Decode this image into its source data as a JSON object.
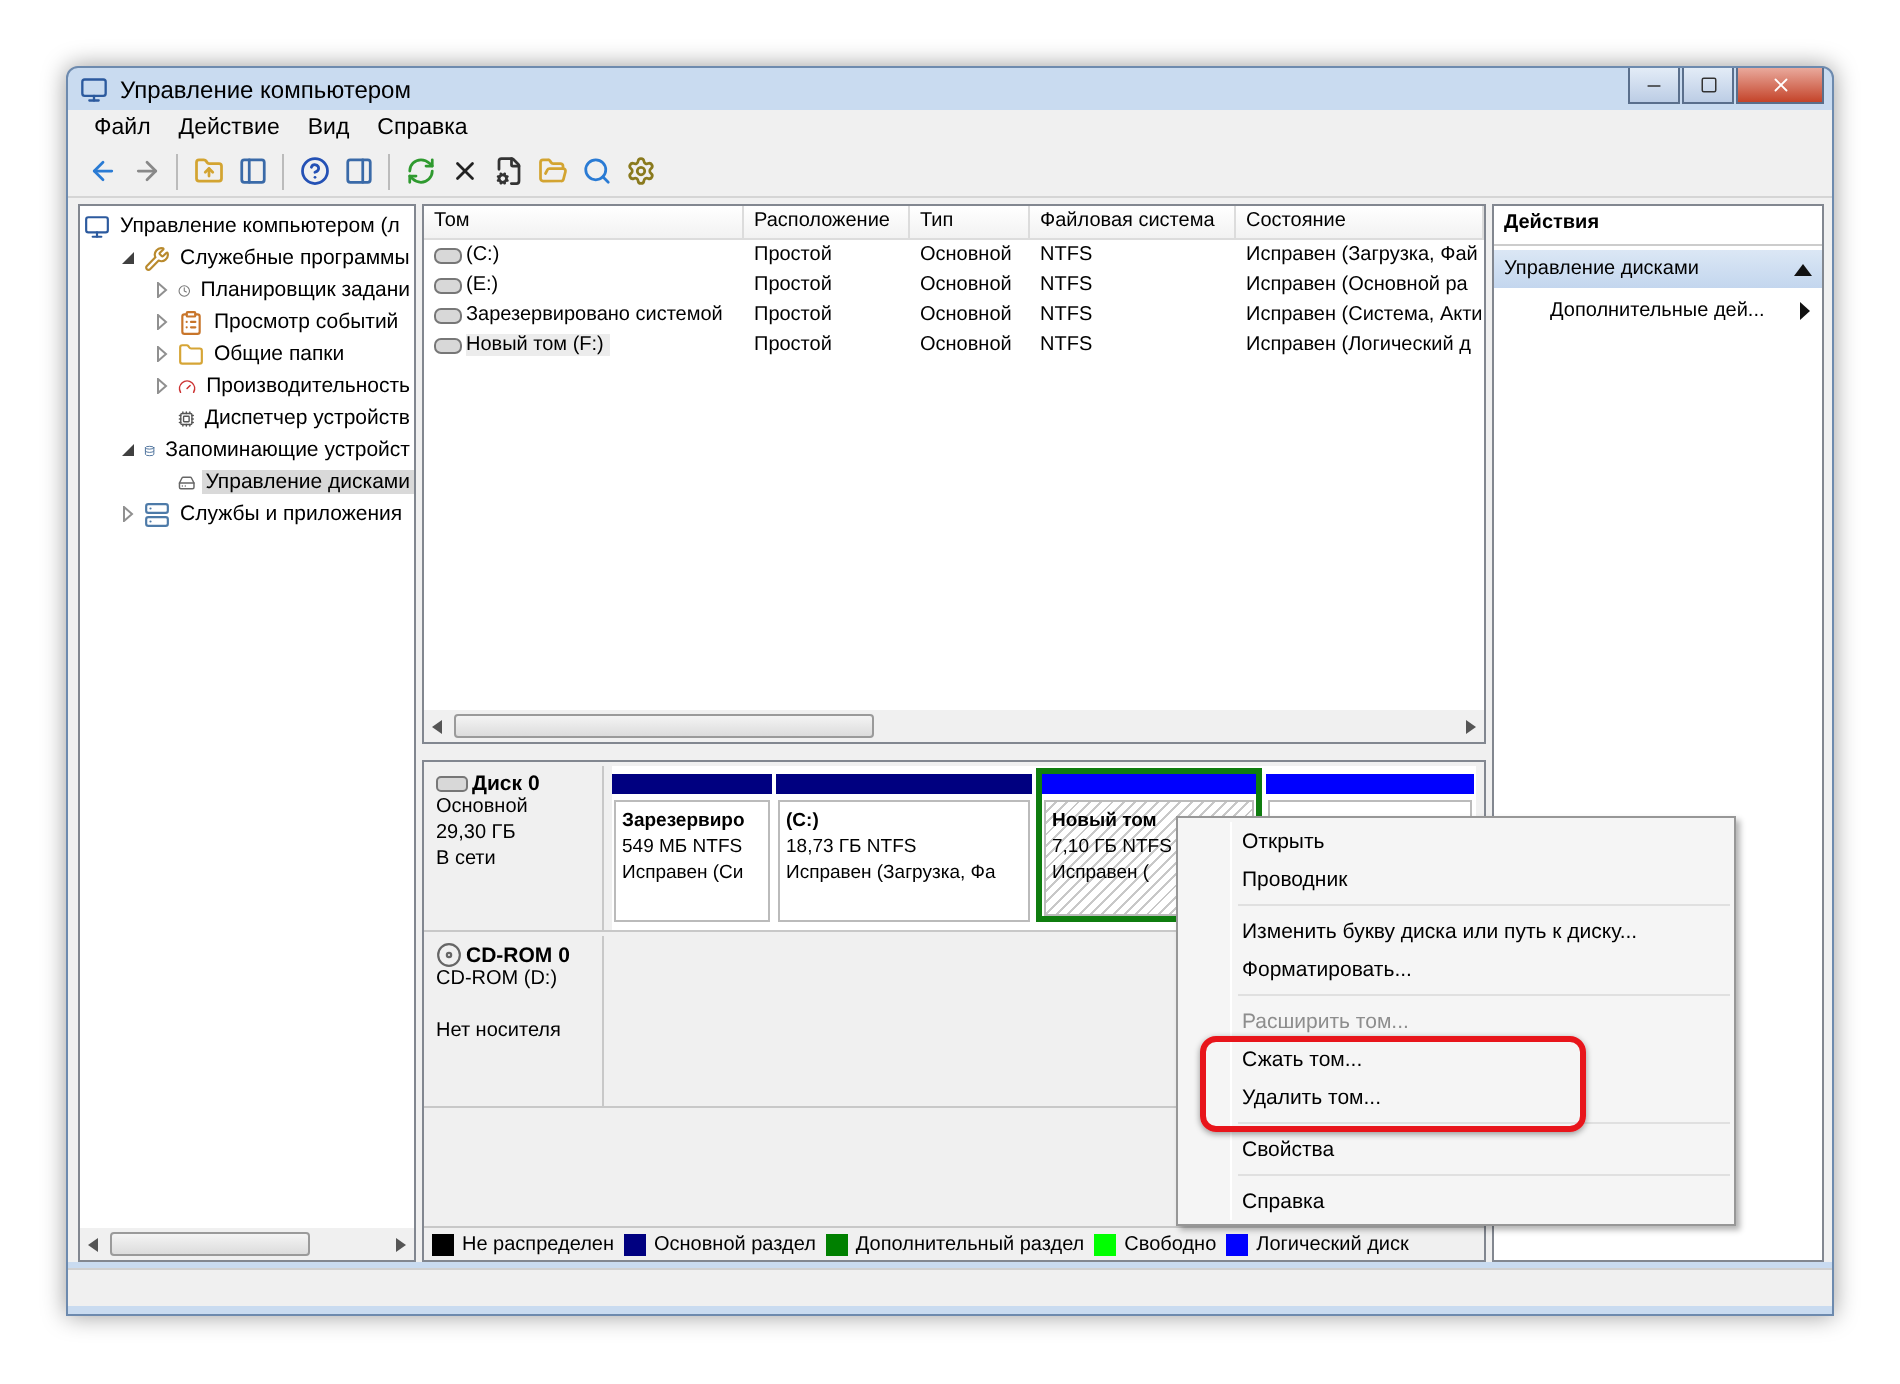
{
  "window": {
    "title": "Управление компьютером"
  },
  "menu_bar": [
    "Файл",
    "Действие",
    "Вид",
    "Справка"
  ],
  "tree": [
    {
      "label": "Управление компьютером (л",
      "selected": false,
      "children": [
        {
          "label": "Служебные программы",
          "expanded": true,
          "selected": false,
          "children": [
            {
              "label": "Планировщик задани",
              "expanded": false,
              "selected": false
            },
            {
              "label": "Просмотр событий",
              "expanded": false,
              "selected": false
            },
            {
              "label": "Общие папки",
              "expanded": false,
              "selected": false
            },
            {
              "label": "Производительность",
              "expanded": false,
              "selected": false
            },
            {
              "label": "Диспетчер устройств",
              "selected": false
            }
          ]
        },
        {
          "label": "Запоминающие устройст",
          "expanded": true,
          "selected": false,
          "children": [
            {
              "label": "Управление дисками",
              "selected": true
            }
          ]
        },
        {
          "label": "Службы и приложения",
          "expanded": false,
          "selected": false
        }
      ]
    }
  ],
  "table": {
    "columns": [
      "Том",
      "Расположение",
      "Тип",
      "Файловая система",
      "Состояние"
    ],
    "rows": [
      {
        "cells": [
          "(C:)",
          "Простой",
          "Основной",
          "NTFS",
          "Исправен (Загрузка, Фай"
        ],
        "selected": false
      },
      {
        "cells": [
          "(E:)",
          "Простой",
          "Основной",
          "NTFS",
          "Исправен (Основной ра"
        ],
        "selected": false
      },
      {
        "cells": [
          "Зарезервировано системой",
          "Простой",
          "Основной",
          "NTFS",
          "Исправен (Система, Акти"
        ],
        "selected": false
      },
      {
        "cells": [
          "Новый том (F:)",
          "Простой",
          "Основной",
          "NTFS",
          "Исправен (Логический д"
        ],
        "selected": true
      }
    ]
  },
  "disks": [
    {
      "kind": "disk",
      "name": "Диск 0",
      "lines": [
        "Основной",
        "29,30 ГБ"
      ],
      "status": "В сети",
      "partitions": [
        {
          "title": "Зарезервиро",
          "size": "549 МБ NTFS",
          "status": "Исправен (Си",
          "color": "#000080",
          "selected": false
        },
        {
          "title": "(C:)",
          "size": "18,73 ГБ NTFS",
          "status": "Исправен (Загрузка, Фа",
          "color": "#000080",
          "selected": false
        },
        {
          "title": "Новый том",
          "size": "7,10 ГБ NTFS",
          "status": "Исправен (",
          "color": "#0000ff",
          "selected": true
        },
        {
          "color": "#0000ff",
          "selected": false
        }
      ]
    },
    {
      "kind": "cdrom",
      "name": "CD-ROM 0",
      "lines": [
        "CD-ROM (D:)"
      ],
      "status": "Нет носителя"
    }
  ],
  "legend": [
    {
      "label": "Не распределен",
      "color": "#000000"
    },
    {
      "label": "Основной раздел",
      "color": "#000080"
    },
    {
      "label": "Дополнительный раздел",
      "color": "#008000"
    },
    {
      "label": "Свободно",
      "color": "#00ff00"
    },
    {
      "label": "Логический диск",
      "color": "#0000ff"
    }
  ],
  "actions": {
    "title": "Действия",
    "section": {
      "label": "Управление дисками",
      "expanded": true
    },
    "items": [
      "Дополнительные дей..."
    ]
  },
  "context_menu": [
    [
      {
        "kind": "item",
        "label": "Открыть",
        "disabled": false
      },
      {
        "kind": "item",
        "label": "Проводник",
        "disabled": false
      }
    ],
    [
      {
        "kind": "item",
        "label": "Изменить букву диска или путь к диску...",
        "disabled": false
      },
      {
        "kind": "item",
        "label": "Форматировать...",
        "disabled": false
      }
    ],
    [
      {
        "kind": "item",
        "label": "Расширить том...",
        "disabled": true
      },
      {
        "kind": "highlight",
        "items": [
          {
            "label": "Сжать том...",
            "disabled": false
          },
          {
            "label": "Удалить том...",
            "disabled": false
          }
        ]
      }
    ],
    [
      {
        "kind": "item",
        "label": "Свойства",
        "disabled": false
      }
    ],
    [
      {
        "kind": "item",
        "label": "Справка",
        "disabled": false
      }
    ]
  ]
}
